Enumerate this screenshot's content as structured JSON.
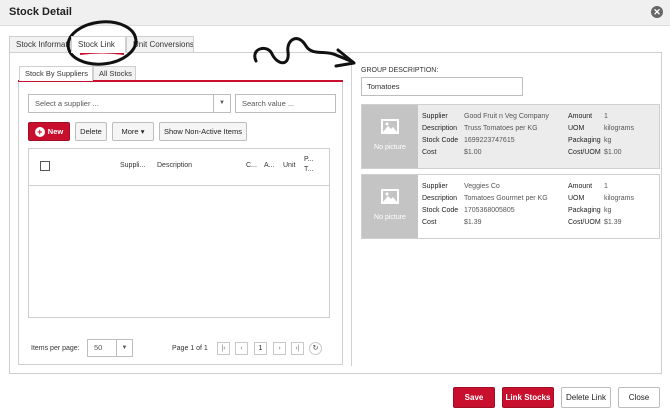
{
  "dialog": {
    "title": "Stock Detail"
  },
  "tabs": [
    {
      "label": "Stock Information"
    },
    {
      "label": "Stock Link"
    },
    {
      "label": "Unit Conversions"
    }
  ],
  "subtabs": [
    {
      "label": "Stock By Suppliers"
    },
    {
      "label": "All Stocks"
    }
  ],
  "filters": {
    "supplier_placeholder": "Select a supplier ...",
    "search_placeholder": "Search value ..."
  },
  "toolbar": {
    "new_label": "New",
    "delete_label": "Delete",
    "more_label": "More",
    "show_inactive_label": "Show Non-Active Items"
  },
  "grid": {
    "columns": [
      "Suppli...",
      "Description",
      "C...",
      "A...",
      "Unit",
      "P... T..."
    ]
  },
  "pager": {
    "items_per_page_label": "Items per page:",
    "items_per_page_value": "50",
    "page_info": "Page 1 of 1",
    "current_page": "1"
  },
  "group": {
    "label": "GROUP DESCRIPTION:",
    "value": "Tomatoes"
  },
  "cards": [
    {
      "no_picture": "No picture",
      "supplier_label": "Supplier",
      "supplier": "Good Fruit n Veg Company",
      "description_label": "Description",
      "description": "Truss Tomatoes per KG",
      "stock_code_label": "Stock Code",
      "stock_code": "1699223747615",
      "cost_label": "Cost",
      "cost": "$1.00",
      "amount_label": "Amount",
      "amount": "1",
      "uom_label": "UOM",
      "uom": "kilograms",
      "packaging_label": "Packaging",
      "packaging": "kg",
      "cost_uom_label": "Cost/UOM",
      "cost_uom": "$1.00"
    },
    {
      "no_picture": "No picture",
      "supplier_label": "Supplier",
      "supplier": "Veggies Co",
      "description_label": "Description",
      "description": "Tomatoes Gourmet per KG",
      "stock_code_label": "Stock Code",
      "stock_code": "1705368005805",
      "cost_label": "Cost",
      "cost": "$1.39",
      "amount_label": "Amount",
      "amount": "1",
      "uom_label": "UOM",
      "uom": "kilograms",
      "packaging_label": "Packaging",
      "packaging": "kg",
      "cost_uom_label": "Cost/UOM",
      "cost_uom": "$1.39"
    }
  ],
  "footer": {
    "save_label": "Save",
    "link_stocks_label": "Link Stocks",
    "delete_link_label": "Delete Link",
    "close_label": "Close"
  },
  "colors": {
    "accent": "#c8102e",
    "header_bg": "#f0f0f0",
    "card_selected": "#ececec"
  }
}
